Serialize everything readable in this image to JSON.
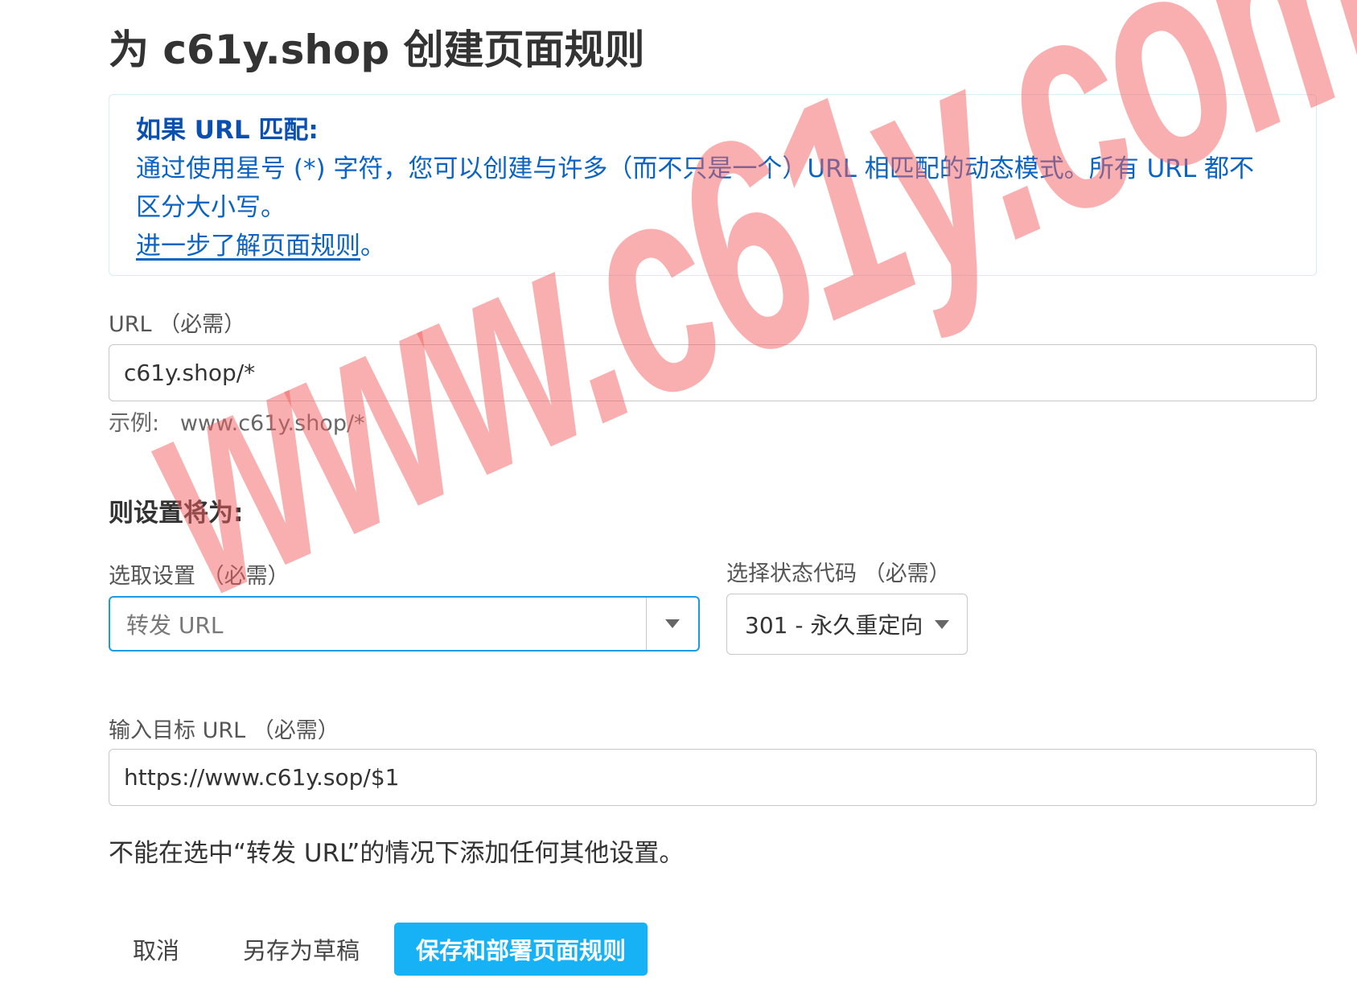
{
  "page": {
    "title": "为 c61y.shop 创建页面规则"
  },
  "info_box": {
    "heading": "如果 URL 匹配:",
    "body_line1": "通过使用星号 (*) 字符，您可以创建与许多（而不只是一个）URL 相匹配的动态模式。所有 URL 都不",
    "body_line2": "区分大小写。",
    "link_text": "进一步了解页面规则",
    "link_suffix": "。"
  },
  "url_field": {
    "label": "URL （必需）",
    "value": "c61y.shop/*",
    "example_prefix": "示例:",
    "example_value": "www.c61y.shop/*"
  },
  "settings": {
    "heading": "则设置将为:",
    "setting_label": "选取设置 （必需）",
    "setting_value": "转发 URL",
    "status_label": "选择状态代码 （必需）",
    "status_value": "301 - 永久重定向"
  },
  "target_field": {
    "label": "输入目标 URL （必需）",
    "value": "https://www.c61y.sop/$1"
  },
  "notice": "不能在选中“转发 URL”的情况下添加任何其他设置。",
  "actions": {
    "cancel_label": "取消",
    "draft_label": "另存为草稿",
    "save_label": "保存和部署页面规则"
  },
  "watermark": "www.c61y.com",
  "colors": {
    "accent": "#16b2f5",
    "info_text": "#0b63c4",
    "focus_border": "#1a9be6"
  }
}
